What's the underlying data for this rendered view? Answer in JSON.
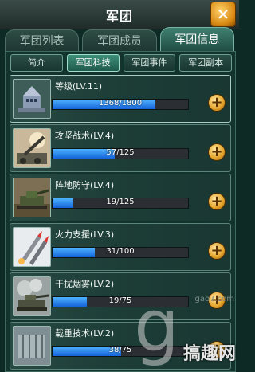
{
  "window": {
    "title": "军团",
    "close_label": "✕"
  },
  "tabs": [
    {
      "label": "军团列表",
      "active": false
    },
    {
      "label": "军团成员",
      "active": false
    },
    {
      "label": "军团信息",
      "active": true
    }
  ],
  "subtabs": [
    {
      "label": "简介",
      "active": false
    },
    {
      "label": "军团科技",
      "active": true
    },
    {
      "label": "军团事件",
      "active": false
    },
    {
      "label": "军团副本",
      "active": false
    }
  ],
  "techs": [
    {
      "label": "等级(LV.11)",
      "progress_text": "1368/1800",
      "progress": 0.76,
      "icon": "headquarters-icon"
    },
    {
      "label": "攻坚战术(LV.4)",
      "progress_text": "57/125",
      "progress": 0.456,
      "icon": "artillery-icon"
    },
    {
      "label": "阵地防守(LV.4)",
      "progress_text": "19/125",
      "progress": 0.152,
      "icon": "fortified-tank-icon"
    },
    {
      "label": "火力支援(LV.3)",
      "progress_text": "31/100",
      "progress": 0.31,
      "icon": "missile-icon"
    },
    {
      "label": "干扰烟雾(LV.2)",
      "progress_text": "19/75",
      "progress": 0.253,
      "icon": "smoke-tank-icon"
    },
    {
      "label": "载重技术(LV.2)",
      "progress_text": "38/75",
      "progress": 0.507,
      "icon": "cargo-container-icon"
    }
  ],
  "watermark": {
    "site": "gao7.com",
    "brand": "搞趣网",
    "glyph": "g"
  },
  "colors": {
    "progress_fill": "#2a86f0",
    "panel_bg": "#12342d",
    "accent_gold": "#e3a32a"
  }
}
